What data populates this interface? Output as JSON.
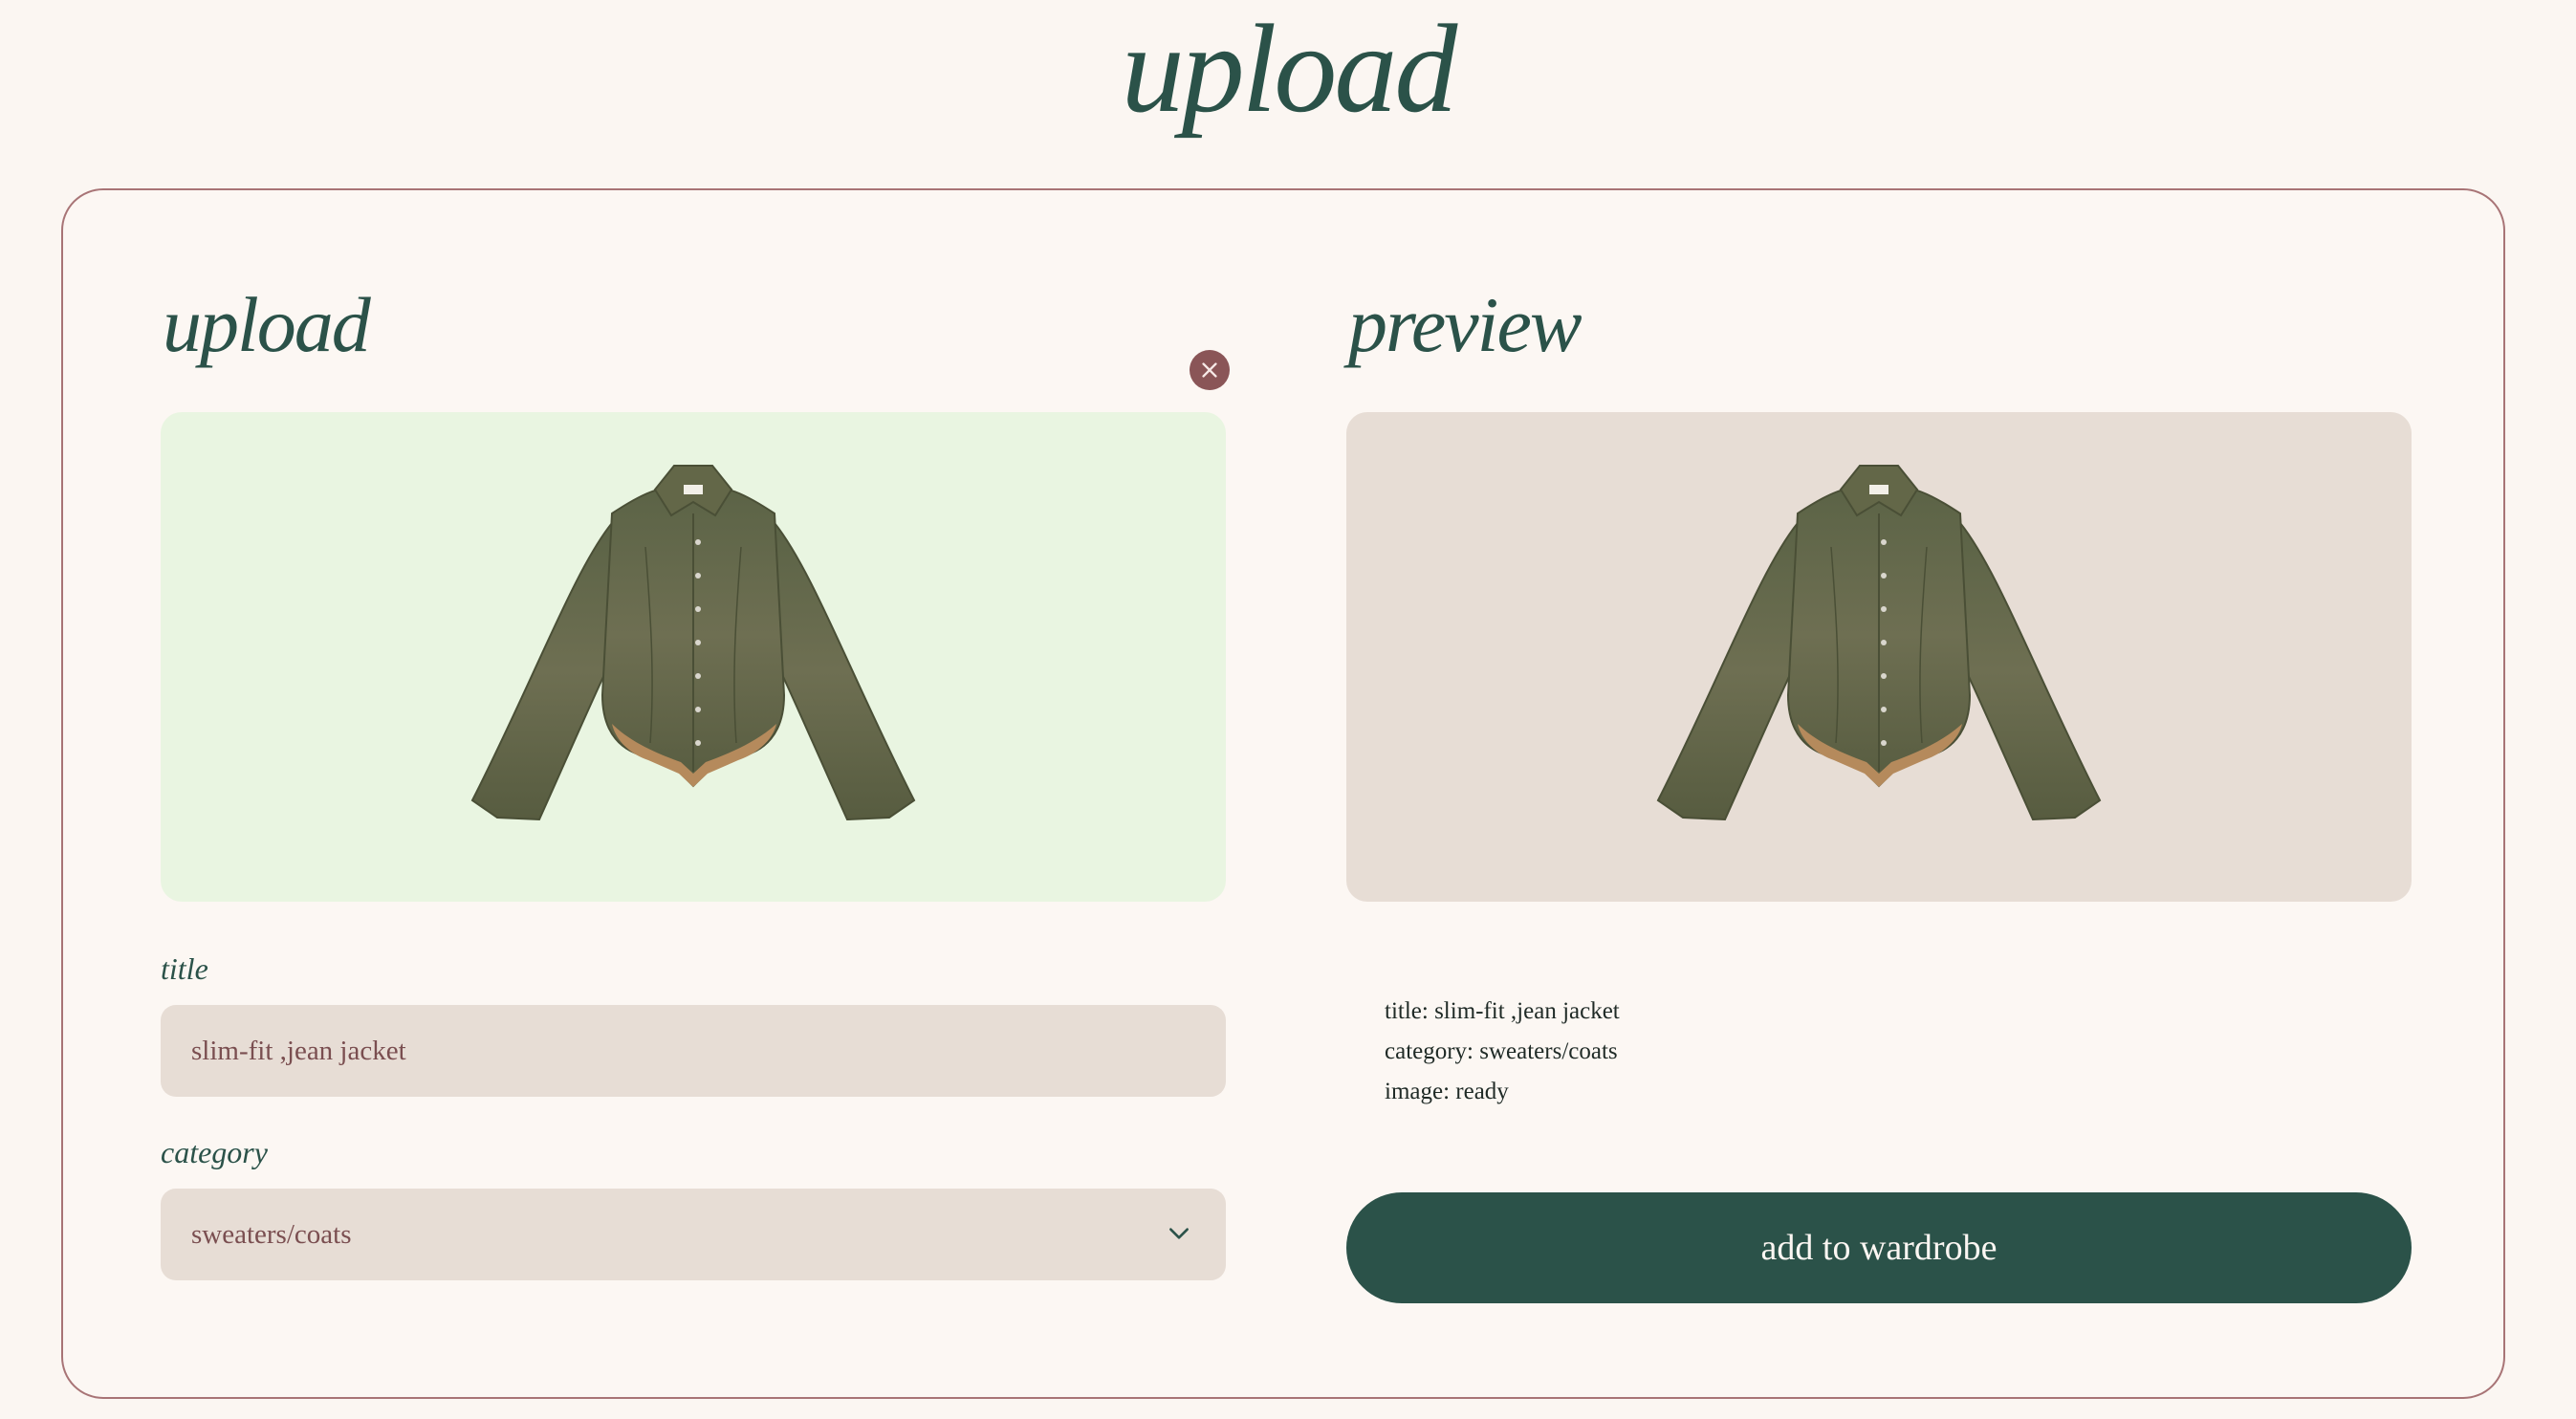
{
  "page": {
    "title": "upload"
  },
  "upload": {
    "heading": "upload",
    "remove_icon": "close-icon",
    "image_alt_icon": "jacket-image",
    "title_label": "title",
    "title_value": "slim-fit ,jean jacket",
    "category_label": "category",
    "category_value": "sweaters/coats",
    "category_icon": "chevron-down-icon"
  },
  "preview": {
    "heading": "preview",
    "lines": {
      "title": "title: slim-fit ,jean jacket",
      "category": "category: sweaters/coats",
      "image": "image: ready"
    },
    "add_button_label": "add to wardrobe"
  },
  "colors": {
    "background": "#fbf6f2",
    "accent_green": "#2b5249",
    "remove_red": "#8a5557",
    "upload_bg": "#e9f5e1",
    "preview_bg": "#e7ddd5",
    "field_bg": "#e7ddd5",
    "border": "#a87476"
  }
}
